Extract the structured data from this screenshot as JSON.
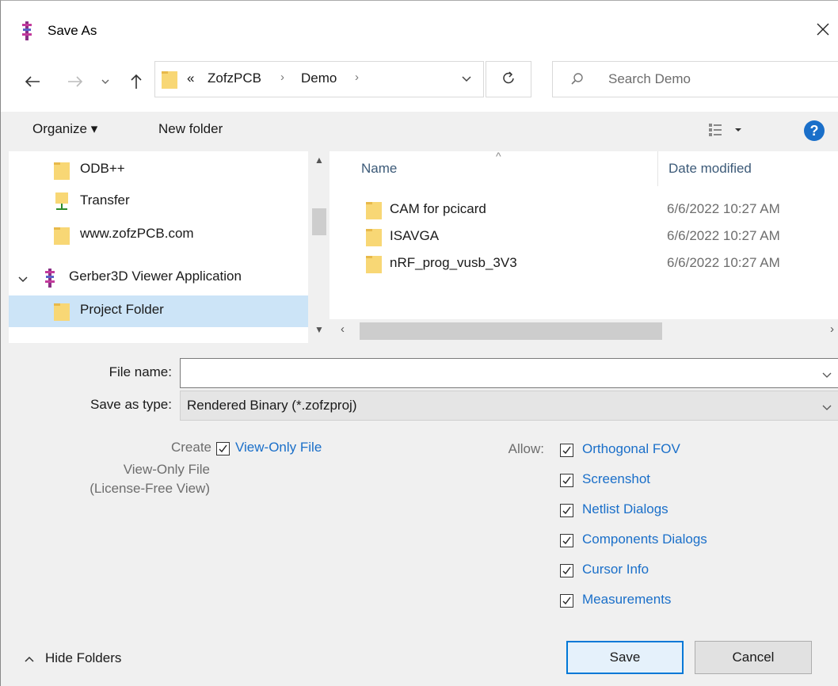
{
  "window": {
    "title": "Save As",
    "icons": {
      "app": "gerber3d-app-icon",
      "close": "close-icon"
    }
  },
  "nav": {
    "back_icon": "arrow-left-icon",
    "forward_icon": "arrow-right-icon",
    "recent_icon": "chevron-down-icon",
    "up_icon": "arrow-up-icon",
    "breadcrumb": {
      "overflow": "«",
      "items": [
        "ZofzPCB",
        "Demo"
      ],
      "separator": "›"
    },
    "refresh_icon": "refresh-icon",
    "search_placeholder": "Search Demo"
  },
  "toolbar": {
    "organize": "Organize ▾",
    "new_folder": "New folder",
    "view_icon": "view-options-icon",
    "help": "?"
  },
  "sidebar": {
    "items": [
      {
        "label": "ODB++",
        "icon": "folder-icon"
      },
      {
        "label": "Transfer",
        "icon": "network-folder-icon"
      },
      {
        "label": "www.zofzPCB.com",
        "icon": "folder-icon"
      },
      {
        "label": "Gerber3D Viewer Application",
        "icon": "gerber3d-app-icon",
        "expanded": true
      },
      {
        "label": "Project Folder",
        "icon": "folder-icon",
        "selected": true
      }
    ]
  },
  "filelist": {
    "columns": {
      "name": "Name",
      "date": "Date modified"
    },
    "rows": [
      {
        "name": "CAM for pcicard",
        "date": "6/6/2022 10:27 AM"
      },
      {
        "name": "ISAVGA",
        "date": "6/6/2022 10:27 AM"
      },
      {
        "name": "nRF_prog_vusb_3V3",
        "date": "6/6/2022 10:27 AM"
      }
    ]
  },
  "form": {
    "file_name_label": "File name:",
    "file_name_value": "",
    "save_type_label": "Save as type:",
    "save_type_value": "Rendered Binary (*.zofzproj)"
  },
  "options": {
    "create_label": "Create",
    "view_only_desc_1": "View-Only File",
    "view_only_desc_2": "(License-Free View)",
    "view_only_checkbox": {
      "label": "View-Only File",
      "checked": true
    },
    "allow_label": "Allow:",
    "allow": [
      {
        "label": "Orthogonal FOV",
        "checked": true
      },
      {
        "label": "Screenshot",
        "checked": true
      },
      {
        "label": "Netlist Dialogs",
        "checked": true
      },
      {
        "label": "Components Dialogs",
        "checked": true
      },
      {
        "label": "Cursor Info",
        "checked": true
      },
      {
        "label": "Measurements",
        "checked": true
      }
    ]
  },
  "footer": {
    "hide_folders": "Hide Folders",
    "save": "Save",
    "cancel": "Cancel"
  },
  "colors": {
    "accent": "#0078d7",
    "link": "#1a6fc9",
    "selection": "#cce4f7"
  }
}
